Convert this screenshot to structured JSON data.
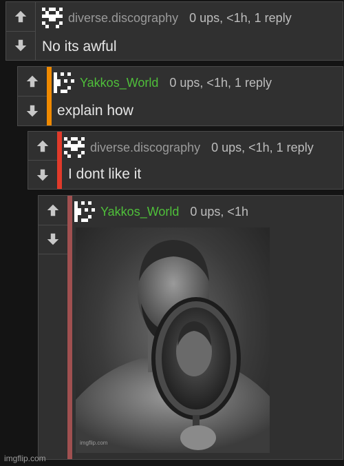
{
  "colors": {
    "panel": "#303030",
    "border": "#4a4a4a",
    "depth_orange": "#f08a00",
    "depth_red": "#e03a2a",
    "depth_muted": "#a05050",
    "username_green": "#4fbf3a"
  },
  "comments": [
    {
      "username": "diverse.discography",
      "meta": "0 ups, <1h, 1 reply",
      "text": "No its awful"
    },
    {
      "username": "Yakkos_World",
      "meta": "0 ups, <1h, 1 reply",
      "text": "explain how"
    },
    {
      "username": "diverse.discography",
      "meta": "0 ups, <1h, 1 reply",
      "text": "I dont like it"
    },
    {
      "username": "Yakkos_World",
      "meta": "0 ups, <1h",
      "image_watermark": "imgflip.com"
    }
  ],
  "footer_watermark": "imgflip.com",
  "icons": {
    "upvote": "arrow-up-icon",
    "downvote": "arrow-down-icon",
    "avatar": "pixel-avatar-icon"
  }
}
